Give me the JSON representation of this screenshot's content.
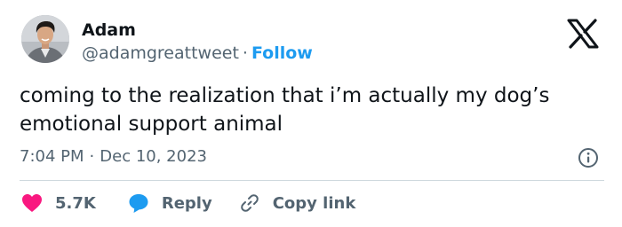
{
  "author": {
    "name": "Adam",
    "handle": "@adamgreattweet",
    "separator": "·",
    "follow_label": "Follow"
  },
  "tweet": {
    "text": "coming to the realization that i’m actually my dog’s emotional support animal",
    "time": "7:04 PM",
    "separator": "·",
    "date": "Dec 10, 2023"
  },
  "actions": {
    "likes": "5.7K",
    "reply_label": "Reply",
    "copy_link_label": "Copy link"
  },
  "icons": {
    "like": "heart-icon",
    "reply": "speech-bubble-icon",
    "copy_link": "link-icon",
    "info": "info-icon",
    "logo": "x-logo-icon"
  },
  "colors": {
    "like": "#f91880",
    "reply": "#1d9bf0",
    "follow": "#1d9bf0",
    "secondary_text": "#536471",
    "primary_text": "#0f1419"
  }
}
